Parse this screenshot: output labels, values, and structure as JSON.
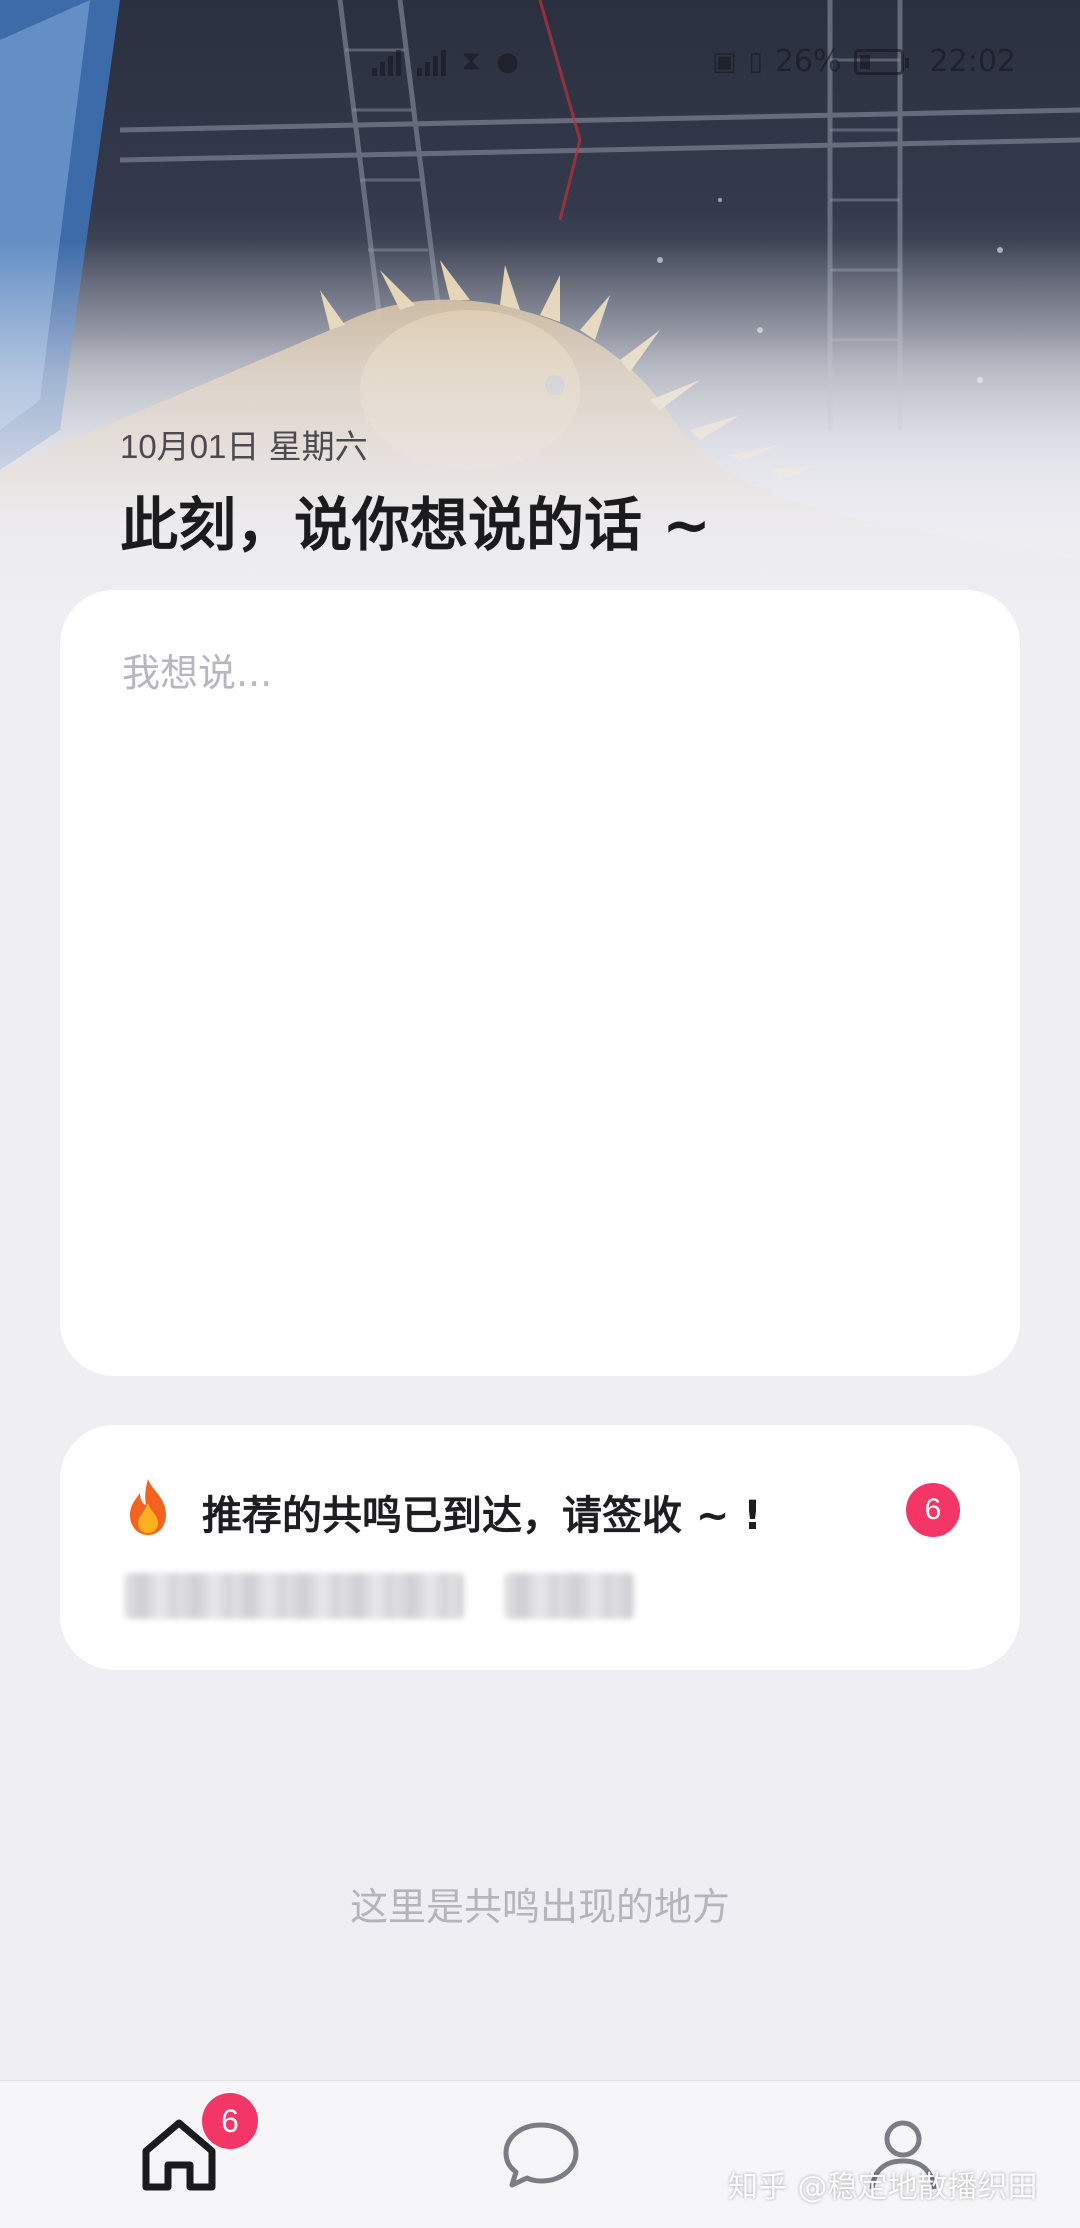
{
  "status_bar": {
    "battery": "26%",
    "time": "22:02"
  },
  "header": {
    "date": "10月01日 星期六",
    "headline": "此刻，说你想说的话 ~"
  },
  "compose": {
    "placeholder": "我想说..."
  },
  "recommendation": {
    "title": "推荐的共鸣已到达，请签收 ~ !",
    "badge_count": "6",
    "icon": "fire-icon"
  },
  "empty_hint": "这里是共鸣出现的地方",
  "tabbar": {
    "home_badge": "6",
    "tabs": [
      "home-icon",
      "chat-bubble-icon",
      "profile-icon"
    ]
  },
  "watermark": "知乎 @稳定地散播织田",
  "colors": {
    "badge": "#f33666",
    "background": "#eeeef3",
    "card": "#ffffff"
  }
}
